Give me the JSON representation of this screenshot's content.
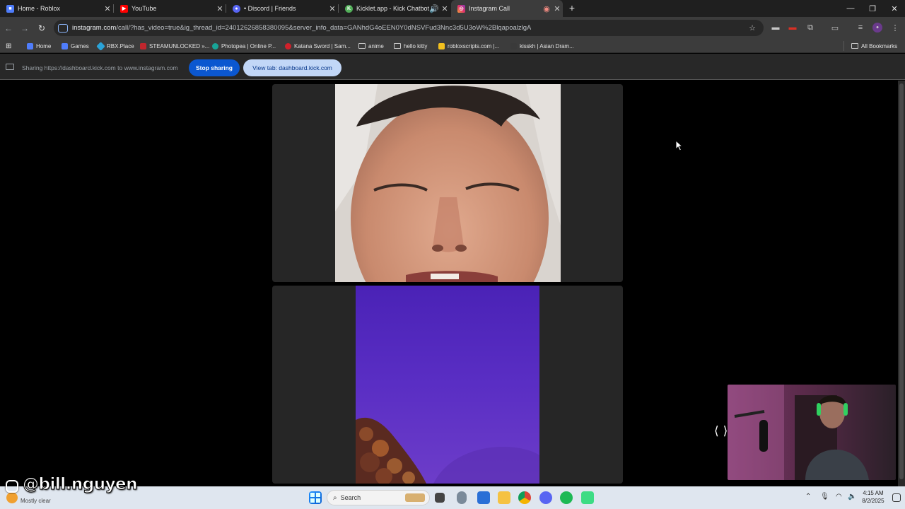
{
  "tabs": [
    {
      "title": "Home - Roblox",
      "favicon_color": "#4f7dfb"
    },
    {
      "title": "YouTube",
      "favicon_color": "#ff0000"
    },
    {
      "title": "• Discord | Friends",
      "favicon_color": "#5865f2"
    },
    {
      "title": "Kicklet.app - Kick Chatbot",
      "favicon_color": "#53b05a"
    },
    {
      "title": "Instagram Call",
      "favicon_color": "#e1306c"
    }
  ],
  "new_tab_glyph": "+",
  "address": {
    "domain": "instagram.com",
    "path": "/call/?has_video=true&ig_thread_id=24012626858380095&server_info_data=GANhdG4oEEN0Y0dNSVFud3Nnc3d5U3oW%2BlqapoalzlgA"
  },
  "bookmarks": [
    {
      "label": "Home"
    },
    {
      "label": "Games"
    },
    {
      "label": "RBX.Place"
    },
    {
      "label": "STEAMUNLOCKED »..."
    },
    {
      "label": "Photopea | Online P..."
    },
    {
      "label": "Katana Sword | Sam..."
    },
    {
      "label": "anime"
    },
    {
      "label": "hello kitty"
    },
    {
      "label": "robloxscripts.com |..."
    },
    {
      "label": "kisskh | Asian Dram..."
    },
    {
      "label": "All Bookmarks"
    }
  ],
  "sharing": {
    "text": "Sharing https://dashboard.kick.com to www.instagram.com",
    "stop_label": "Stop sharing",
    "view_label": "View tab: dashboard.kick.com"
  },
  "taskbar": {
    "search_label": "Search",
    "weather_condition": "Mostly clear",
    "time": "4:15 AM",
    "date": "8/2/2025"
  },
  "overlay": {
    "handle": "@bill.nguyen"
  },
  "colors": {
    "tab_strip": "#1f1f1f",
    "toolbar": "#3c3c3c",
    "stop_button": "#0b57d0",
    "view_button": "#c2d7f7",
    "call_tile": "#262626",
    "video_purple": "#4b23b8"
  }
}
